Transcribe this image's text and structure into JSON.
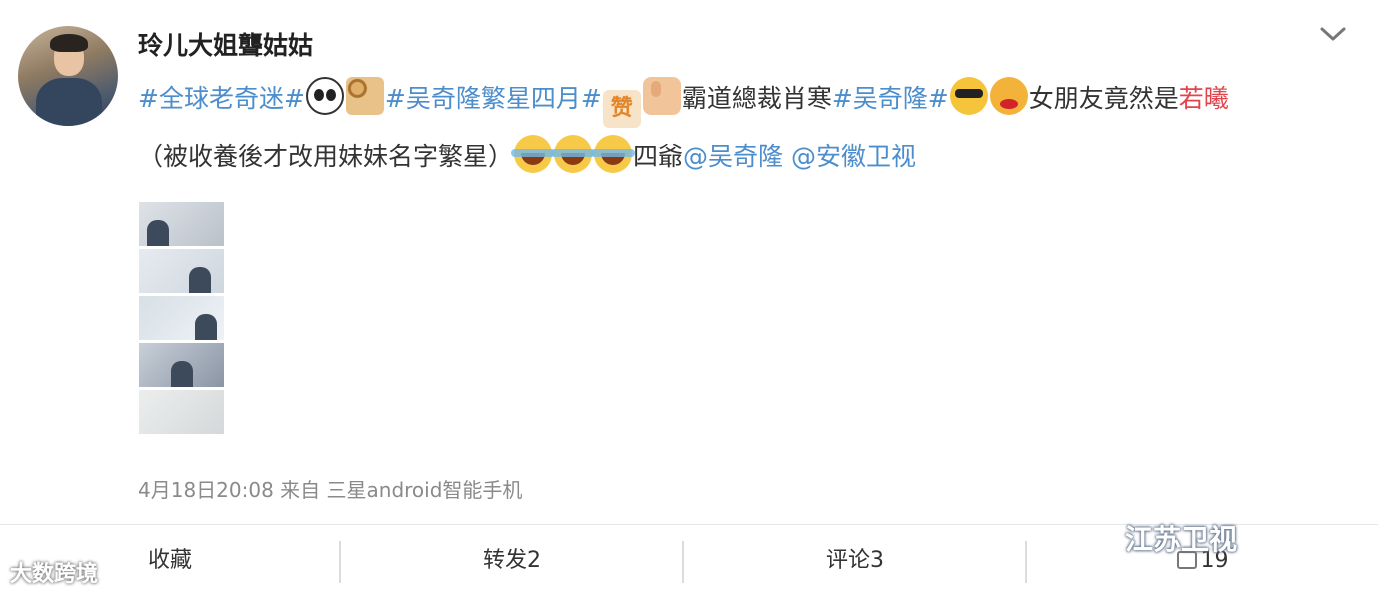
{
  "post": {
    "username": "玲儿大姐聾姑姑",
    "body": {
      "tag1": "#全球老奇迷#",
      "tag2": "#吴奇隆繁星四月#",
      "text1": "霸道總裁肖寒",
      "tag3": "#吴奇隆#",
      "text2": "女朋友竟然是",
      "highlight": "若曦",
      "text3": "（被收養後才改用妹妹名字繁星）",
      "text4": "四爺",
      "mention1": "@吴奇隆",
      "mention2": "@安徽卫视",
      "emoji_zan": "赞"
    },
    "meta": "4月18日20:08 来自 三星android智能手机"
  },
  "actions": {
    "collect": "收藏",
    "repost": "转发2",
    "comment": "评论3",
    "like": "19"
  },
  "watermarks": {
    "right": "江苏卫视",
    "left": "大数跨境"
  },
  "icons": [
    "chevron-down-icon",
    "panda-emoji",
    "bread-emoji",
    "zan-emoji",
    "thumbs-up-emoji",
    "cool-emoji",
    "blush-emoji",
    "laugh-cry-emoji",
    "like-icon"
  ],
  "colors": {
    "link": "#4c8dcc",
    "highlight": "#e0454e",
    "meta": "#8a8a8a"
  }
}
